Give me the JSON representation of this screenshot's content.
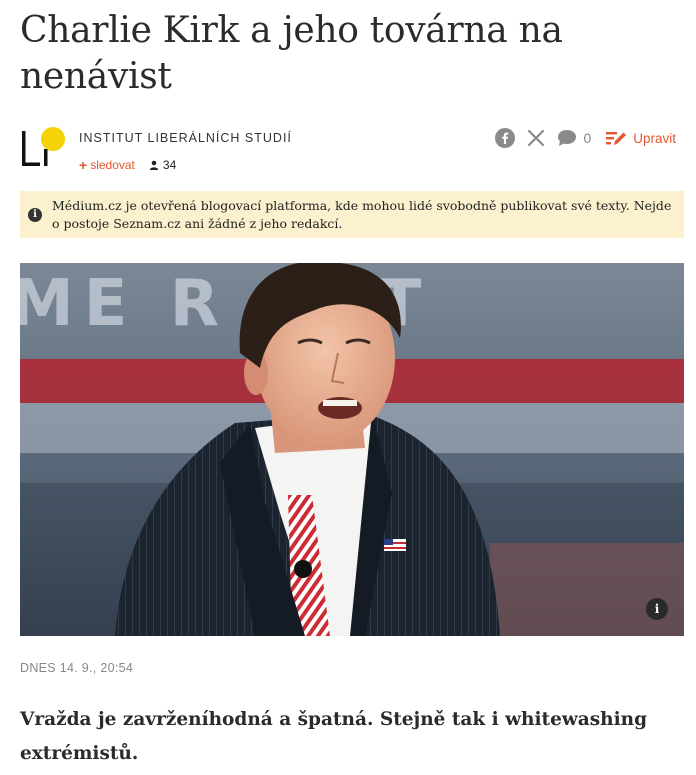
{
  "article": {
    "title": "Charlie Kirk a jeho továrna na nenávist",
    "date": "DNES 14. 9., 20:54",
    "lead": "Vražda je zavrženíhodná a špatná. Stejně tak i whitewashing extrémistů."
  },
  "author": {
    "name": "INSTITUT LIBERÁLNÍCH STUDIÍ",
    "follow_label": "sledovat",
    "followers": "34",
    "logo_letters": "LI"
  },
  "share": {
    "comment_count": "0",
    "edit_label": "Upravit",
    "icons": [
      "facebook-icon",
      "x-icon",
      "comment-icon",
      "edit-pen-icon"
    ]
  },
  "notice": {
    "icon": "i",
    "text": "Médium.cz je otevřená blogovací platforma, kde mohou lidé svobodně publikovat své texty. Nejde o postoje Seznam.cz ani žádné z jeho redakcí."
  },
  "hero": {
    "background_text": "ME  R  ACT",
    "info_label": "i"
  },
  "colors": {
    "accent": "#e6562f",
    "logo_yellow": "#f5d10a",
    "notice_bg": "#fbf1cf"
  }
}
